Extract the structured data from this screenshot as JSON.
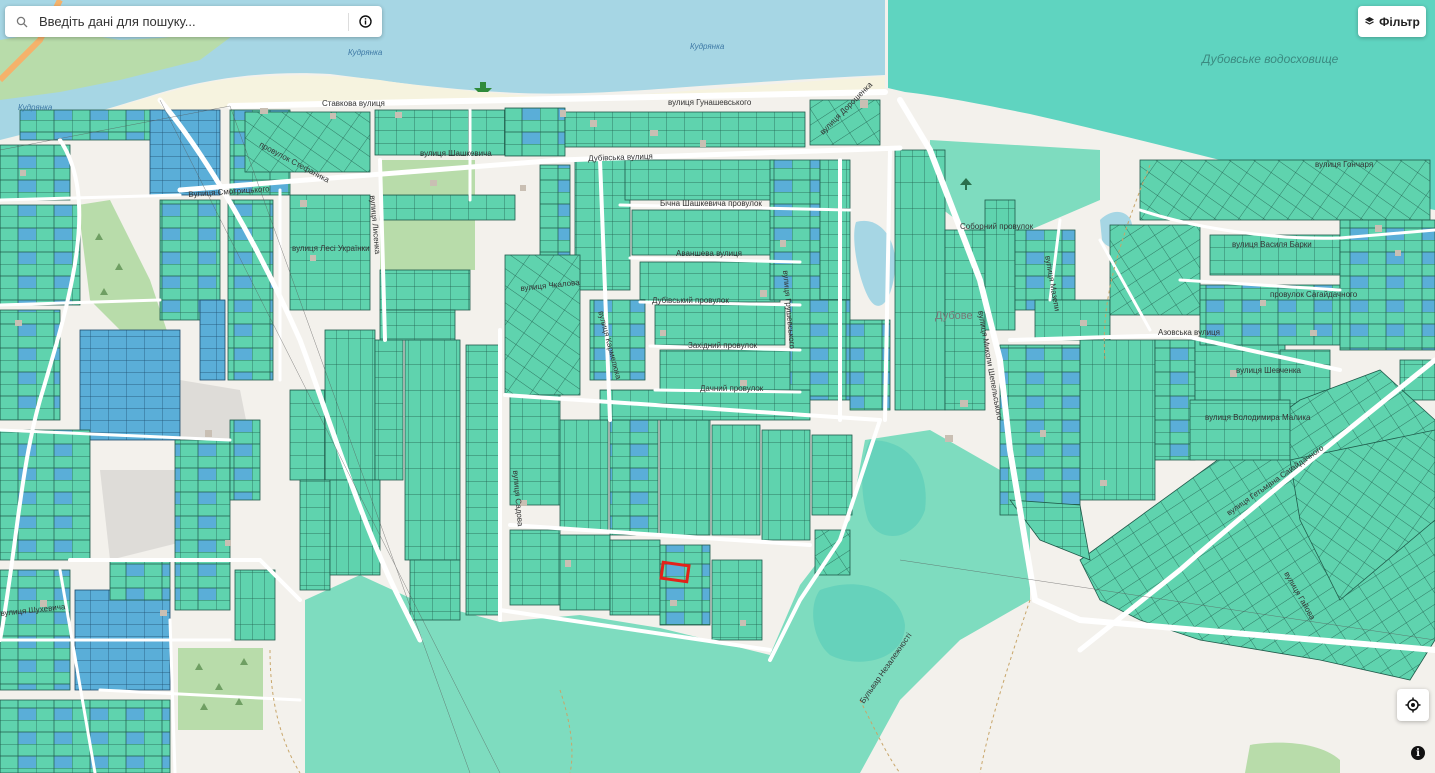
{
  "search": {
    "placeholder": "Введіть дані для пошуку..."
  },
  "filter": {
    "label": "Фільтр"
  },
  "colors": {
    "ground": "#f3f1ec",
    "river": "#a6d6e4",
    "reservoir": "#5fd4c0",
    "green_area": "#7edcbf",
    "parcel_green": "#5fd3ae",
    "parcel_blue": "#5aaed8",
    "road": "#ffffff",
    "beach": "#f6f3df",
    "park": "#b8dcaa",
    "selected_outline": "#e3221a"
  },
  "water_labels": [
    "Кудрянка",
    "Кудрянка",
    "Кудрянка",
    "Дубовське водосховище"
  ],
  "street_labels": [
    "Ставкова вулиця",
    "вулиця Гунашевського",
    "вулиця Шашкевича",
    "Дубівська вулиця",
    "провулок Стефаника",
    "Бічна Шашкевича провулок",
    "Аваншева вулиця",
    "Дубівський провулок",
    "Західний провулок",
    "Дачний провулок",
    "Соборний провулок",
    "вулиця Василя Барки",
    "Азовська вулиця",
    "вулиця Володимира Малика",
    "вулиця Гончаря",
    "Дубове",
    "вулиця Шевченка",
    "вулиця Миколи Шепельського",
    "вулиця Гетьмана Сагайдачного",
    "провулок Сагайдачного",
    "вулиця Лесі Українки",
    "вулиця Чкалова",
    "Бульвар Незалежності",
    "Вулиця Смотрицького",
    "вулиця Дорошенка",
    "вулиця Шухевича",
    "вулиця Лисенка",
    "вулиця Мазепи",
    "вулиця Грушевського",
    "вулиця Кармелюка",
    "вулиця Гайова",
    "вулиця Садова"
  ],
  "icons": {
    "search": "search-icon",
    "info": "info-icon",
    "layers": "layers-icon",
    "locate": "crosshair-icon",
    "attribution": "info-icon"
  },
  "attribution": {
    "symbol": "i"
  }
}
